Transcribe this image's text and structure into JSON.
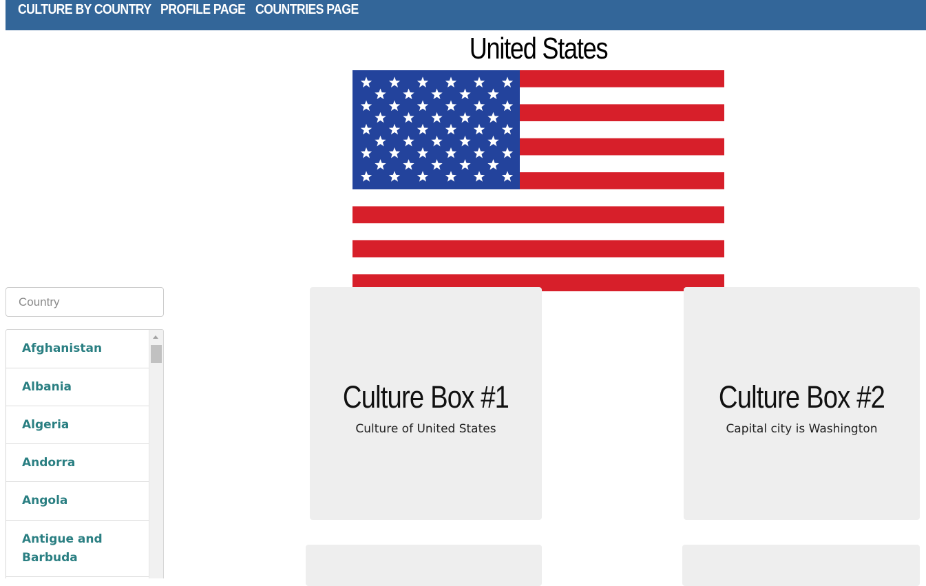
{
  "nav": {
    "brand": "CULTURE BY COUNTRY",
    "profile": "PROFILE PAGE",
    "countries": "COUNTRIES PAGE",
    "color": "#336699"
  },
  "country": {
    "name": "United States",
    "flag_icon": "us-flag"
  },
  "search": {
    "placeholder": "Country",
    "value": ""
  },
  "country_list": [
    "Afghanistan",
    "Albania",
    "Algeria",
    "Andorra",
    "Angola",
    "Antigue and Barbuda"
  ],
  "boxes": [
    {
      "title": "Culture Box #1",
      "text": "Culture of United States"
    },
    {
      "title": "Culture Box #2",
      "text": "Capital city is Washington"
    }
  ],
  "colors": {
    "link": "#2a7f82",
    "box_bg": "#eeeeee",
    "flag_red": "#d71f2a",
    "flag_blue": "#23439c"
  }
}
